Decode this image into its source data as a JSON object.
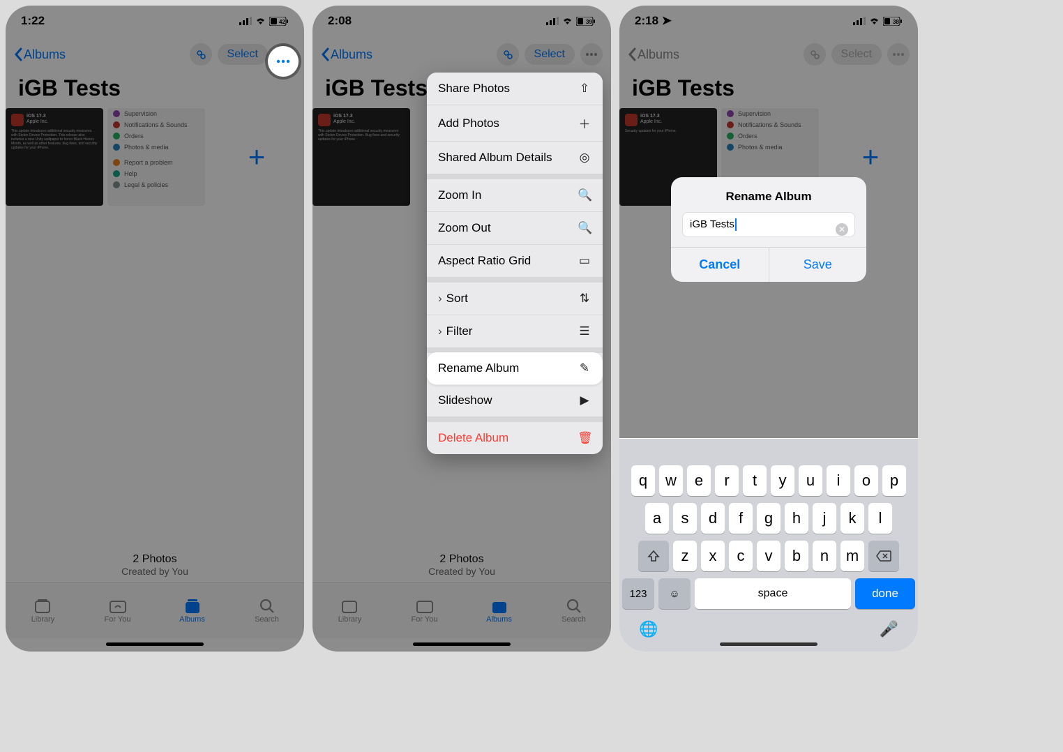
{
  "panel1": {
    "time": "1:22",
    "battery": "42",
    "back_label": "Albums",
    "select_label": "Select",
    "album_title": "iGB Tests",
    "count": "2 Photos",
    "created_by": "Created by You"
  },
  "panel2": {
    "time": "2:08",
    "battery": "39",
    "back_label": "Albums",
    "select_label": "Select",
    "album_title": "iGB Tests",
    "count": "2 Photos",
    "created_by": "Created by You",
    "menu": {
      "share": "Share Photos",
      "add": "Add Photos",
      "details": "Shared Album Details",
      "zoom_in": "Zoom In",
      "zoom_out": "Zoom Out",
      "aspect": "Aspect Ratio Grid",
      "sort": "Sort",
      "filter": "Filter",
      "rename": "Rename Album",
      "slideshow": "Slideshow",
      "delete": "Delete Album"
    }
  },
  "panel3": {
    "time": "2:18",
    "battery": "38",
    "back_label": "Albums",
    "select_label": "Select",
    "album_title": "iGB Tests",
    "dialog": {
      "title": "Rename Album",
      "value": "iGB Tests",
      "cancel": "Cancel",
      "save": "Save"
    },
    "keyboard": {
      "row1": [
        "q",
        "w",
        "e",
        "r",
        "t",
        "y",
        "u",
        "i",
        "o",
        "p"
      ],
      "row2": [
        "a",
        "s",
        "d",
        "f",
        "g",
        "h",
        "j",
        "k",
        "l"
      ],
      "row3": [
        "z",
        "x",
        "c",
        "v",
        "b",
        "n",
        "m"
      ],
      "num": "123",
      "space": "space",
      "done": "done"
    }
  },
  "tabs": {
    "library": "Library",
    "foryou": "For You",
    "albums": "Albums",
    "search": "Search"
  },
  "thumb_sample": {
    "headline": "iOS 17.3",
    "sub": "Apple Inc.",
    "rows": [
      "Supervision",
      "Notifications & Sounds",
      "Orders",
      "Photos & media",
      "Report a problem",
      "Help",
      "Legal & policies"
    ]
  }
}
